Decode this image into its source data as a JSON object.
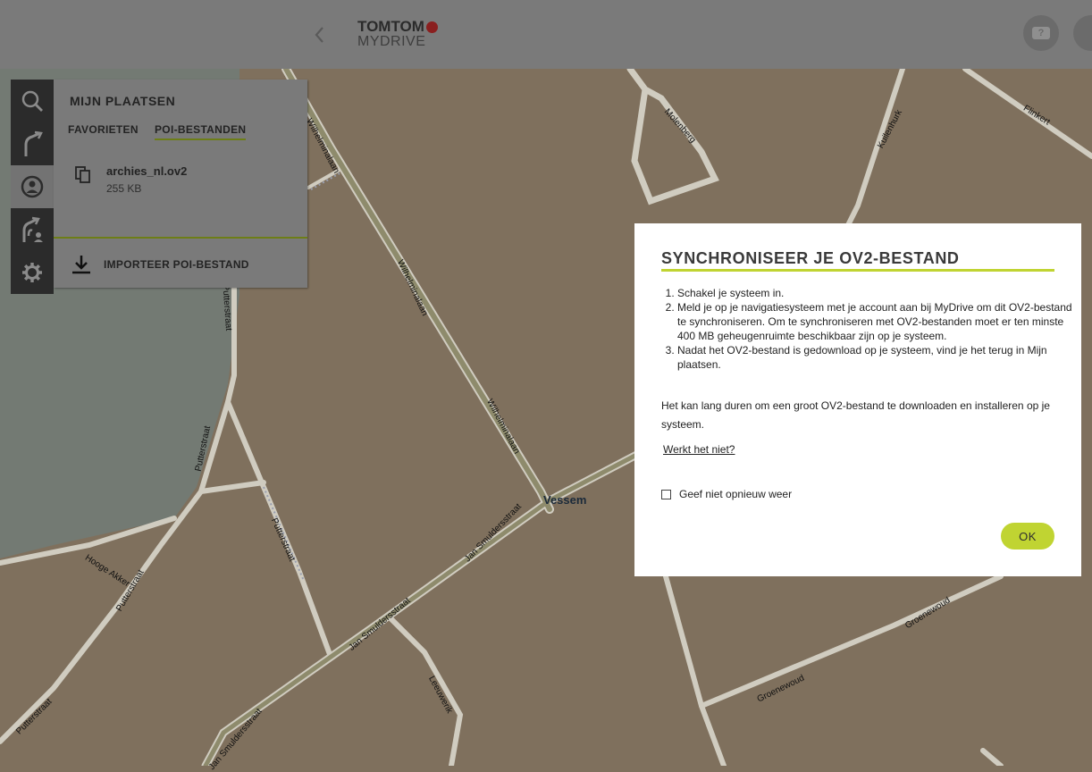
{
  "header": {
    "logo_brand": "TOMTOM",
    "logo_my": "MY",
    "logo_drive": "DRIVE"
  },
  "sidebar": {
    "rail": [
      {
        "icon": "search-icon"
      },
      {
        "icon": "route-icon"
      },
      {
        "icon": "my-places-icon",
        "active": true
      },
      {
        "icon": "route-planner-icon"
      },
      {
        "icon": "gear-icon"
      }
    ],
    "panel_title": "MIJN PLAATSEN",
    "tabs": [
      "FAVORIETEN",
      "POI-BESTANDEN"
    ],
    "active_tab": "POI-BESTANDEN",
    "file": {
      "name": "archies_nl.ov2",
      "size": "255 KB"
    },
    "import_label": "IMPORTEER POI-BESTAND"
  },
  "map": {
    "town": "Vessem",
    "streets": [
      "Wilhelminalaan",
      "Wilhelminalaan",
      "Wilhelminalaan",
      "Molenberg",
      "Kuilenhurk",
      "Flinkert",
      "Putterstraat",
      "Putterstraat",
      "Putterstraat",
      "Putterstraat",
      "Putterstraat",
      "Hooge Akker",
      "Jan Smuldersstraat",
      "Jan Smuldersstraat",
      "Jan Smuldersstraat",
      "Leeuwerik",
      "Groenewoud",
      "Groenewoud"
    ]
  },
  "dialog": {
    "title": "SYNCHRONISEER JE OV2-BESTAND",
    "steps": [
      "Schakel je systeem in.",
      "Meld je op je navigatiesysteem met je account aan bij MyDrive om dit OV2-bestand te synchroniseren. Om te synchroniseren met OV2-bestanden moet er ten minste 400 MB geheugenruimte beschikbaar zijn op je systeem.",
      "Nadat het OV2-bestand is gedownload op je systeem, vind je het terug in Mijn plaatsen."
    ],
    "note": "Het kan lang duren om een groot OV2-bestand te downloaden en installeren op je systeem.",
    "link": "Werkt het niet?",
    "checkbox_label": "Geef niet opnieuw weer",
    "checkbox_checked": false,
    "ok_label": "OK"
  },
  "colors": {
    "accent": "#c0d432",
    "accent_dark": "#6d7e17",
    "rail": "#2b2b2b",
    "map_land": "#7f705d",
    "map_green": "#737a73"
  }
}
